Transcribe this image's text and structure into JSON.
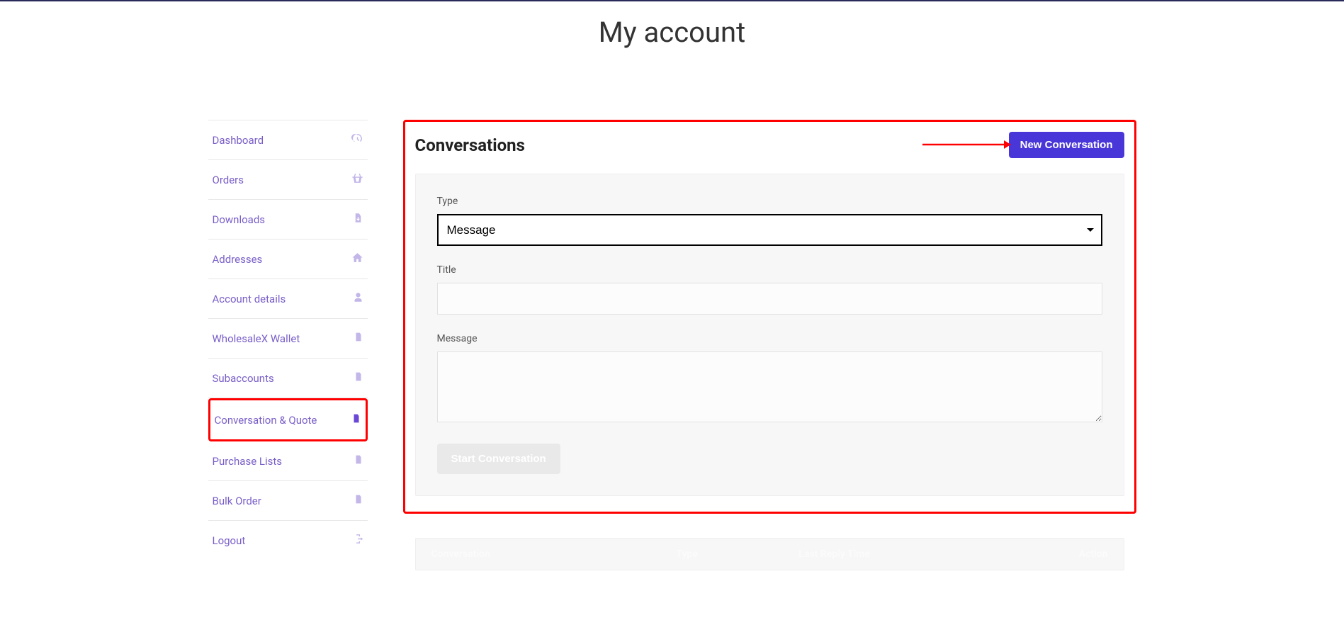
{
  "page_title": "My account",
  "sidebar": {
    "items": [
      {
        "label": "Dashboard",
        "icon": "gauge"
      },
      {
        "label": "Orders",
        "icon": "basket"
      },
      {
        "label": "Downloads",
        "icon": "file-down"
      },
      {
        "label": "Addresses",
        "icon": "home"
      },
      {
        "label": "Account details",
        "icon": "user"
      },
      {
        "label": "WholesaleX Wallet",
        "icon": "file"
      },
      {
        "label": "Subaccounts",
        "icon": "file"
      },
      {
        "label": "Conversation & Quote",
        "icon": "file",
        "active": true
      },
      {
        "label": "Purchase Lists",
        "icon": "file"
      },
      {
        "label": "Bulk Order",
        "icon": "file"
      },
      {
        "label": "Logout",
        "icon": "logout"
      }
    ]
  },
  "main": {
    "heading": "Conversations",
    "new_button": "New Conversation",
    "form": {
      "type_label": "Type",
      "type_value": "Message",
      "title_label": "Title",
      "title_value": "",
      "message_label": "Message",
      "message_value": "",
      "start_button": "Start Conversation"
    },
    "table": {
      "headers": {
        "conversation": "Conversation",
        "type": "Type",
        "last_reply": "Last Reply Time",
        "action": "Action"
      }
    }
  }
}
